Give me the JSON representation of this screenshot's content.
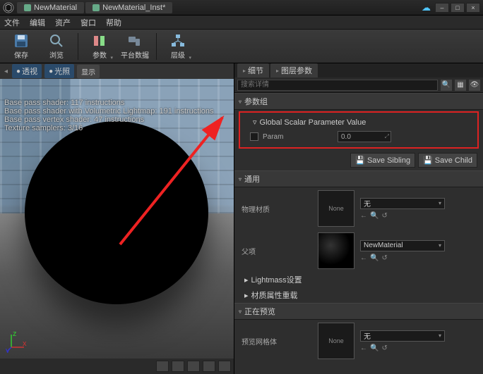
{
  "titleBar": {
    "tabs": [
      "NewMaterial",
      "NewMaterial_Inst*"
    ]
  },
  "menu": [
    "文件",
    "编辑",
    "资产",
    "窗口",
    "帮助"
  ],
  "toolbar": {
    "save": "保存",
    "browse": "浏览",
    "params": "参数",
    "platform": "平台数据",
    "hierarchy": "层级"
  },
  "viewport": {
    "btnPerspective": "透视",
    "btnLit": "光照",
    "btnShow": "显示",
    "stats": [
      "Base pass shader: 117 instructions",
      "Base pass shader with Volumetric Lightmap: 191 instructions",
      "Base pass vertex shader: 47 instructions",
      "Texture samplers: 3/16"
    ]
  },
  "rightPanel": {
    "tabDetails": "细节",
    "tabLayerParams": "图层参数",
    "searchPlaceholder": "搜索详情",
    "sections": {
      "paramGroup": "参数组",
      "globalScalar": "Global Scalar Parameter Value",
      "paramName": "Param",
      "paramValue": "0.0",
      "saveSibling": "Save Sibling",
      "saveChild": "Save Child",
      "general": "通用",
      "physMat": "物理材质",
      "parent": "父项",
      "none": "None",
      "newMaterial": "NewMaterial",
      "lightmass": "Lightmass设置",
      "matOverride": "材质属性重载",
      "previewing": "正在预览",
      "previewMesh": "预览网格体",
      "noneDrop": "无"
    }
  }
}
